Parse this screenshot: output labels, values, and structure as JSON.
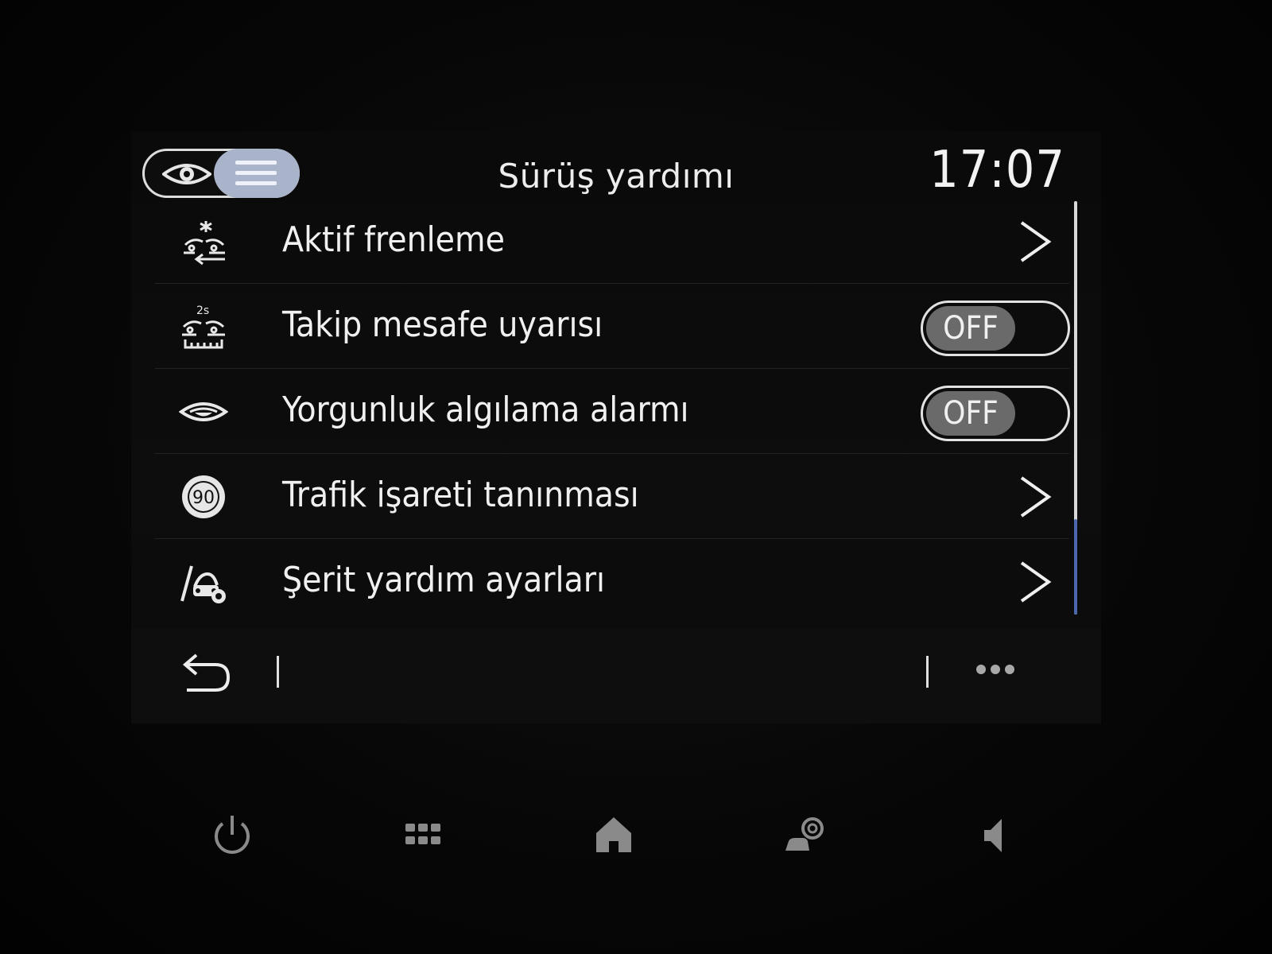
{
  "header": {
    "title": "Sürüş yardımı",
    "clock": "17:07",
    "mode_toggle": {
      "left_icon": "eye-icon",
      "right_icon": "list-icon",
      "active": "list"
    }
  },
  "settings": [
    {
      "label": "Aktif frenleme",
      "icon": "active-braking-icon",
      "control": "chevron"
    },
    {
      "label": "Takip mesafe uyarısı",
      "icon": "distance-warning-icon",
      "control": "switch",
      "state": "OFF"
    },
    {
      "label": "Yorgunluk algılama alarmı",
      "icon": "fatigue-eye-icon",
      "control": "switch",
      "state": "OFF"
    },
    {
      "label": "Trafik işareti tanınması",
      "icon": "speed-sign-icon",
      "icon_text": "90",
      "control": "chevron"
    },
    {
      "label": "Şerit yardım ayarları",
      "icon": "lane-assist-icon",
      "control": "chevron"
    }
  ],
  "bottom_bar": {
    "back_icon": "back-arrow-icon",
    "more_icon": "more-dots-icon"
  },
  "dock": [
    "power-icon",
    "apps-grid-icon",
    "home-icon",
    "car-settings-icon",
    "volume-icon"
  ],
  "colors": {
    "accent": "#a9b3c9",
    "switch_knob": "#6a6a6a",
    "scroll_accent": "#4a67b0"
  }
}
